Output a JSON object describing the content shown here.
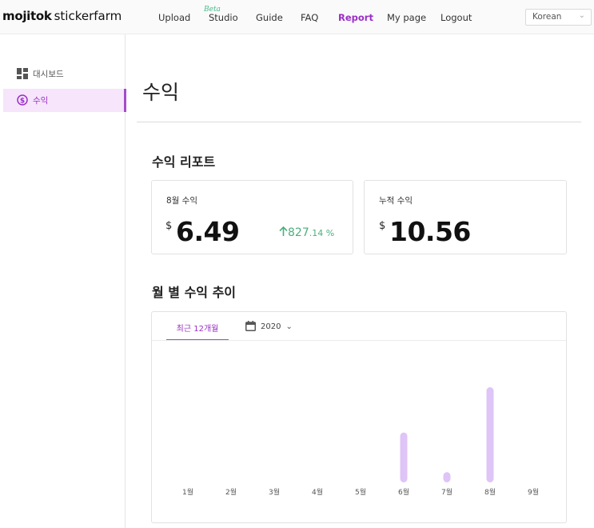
{
  "header": {
    "logo_bold": "mojitok",
    "logo_rest": "stickerfarm",
    "nav": [
      {
        "label": "Upload",
        "active": false
      },
      {
        "label": "Studio",
        "active": false
      },
      {
        "label": "Guide",
        "active": false
      },
      {
        "label": "FAQ",
        "active": false
      },
      {
        "label": "Report",
        "active": true
      },
      {
        "label": "My page",
        "active": false
      },
      {
        "label": "Logout",
        "active": false
      }
    ],
    "beta_badge": "Beta",
    "language": "Korean",
    "accent_color": "#9b2ec7"
  },
  "sidebar": {
    "items": [
      {
        "label": "대시보드",
        "icon": "dashboard-icon",
        "active": false
      },
      {
        "label": "수익",
        "icon": "dollar-circle-icon",
        "active": true
      }
    ]
  },
  "main": {
    "title": "수익",
    "report_title": "수익 리포트",
    "cards": [
      {
        "label": "8월 수익",
        "currency": "$",
        "amount": "6.49",
        "change_value": "827",
        "change_fraction": ".14 %",
        "change_icon": "arrow-up-icon"
      },
      {
        "label": "누적 수익",
        "currency": "$",
        "amount": "10.56"
      }
    ],
    "trend_title": "월 별 수익 추이",
    "chart_tab": "최근 12개월",
    "year_select": "2020"
  },
  "chart_data": {
    "type": "bar",
    "categories": [
      "1월",
      "2월",
      "3월",
      "4월",
      "5월",
      "6월",
      "7월",
      "8월",
      "9월"
    ],
    "values": [
      0,
      0,
      0,
      0,
      0,
      3.4,
      0.7,
      6.49,
      0
    ],
    "ylim": [
      0,
      7.8
    ],
    "grid": false,
    "bar_color": "#dfc4f7"
  }
}
